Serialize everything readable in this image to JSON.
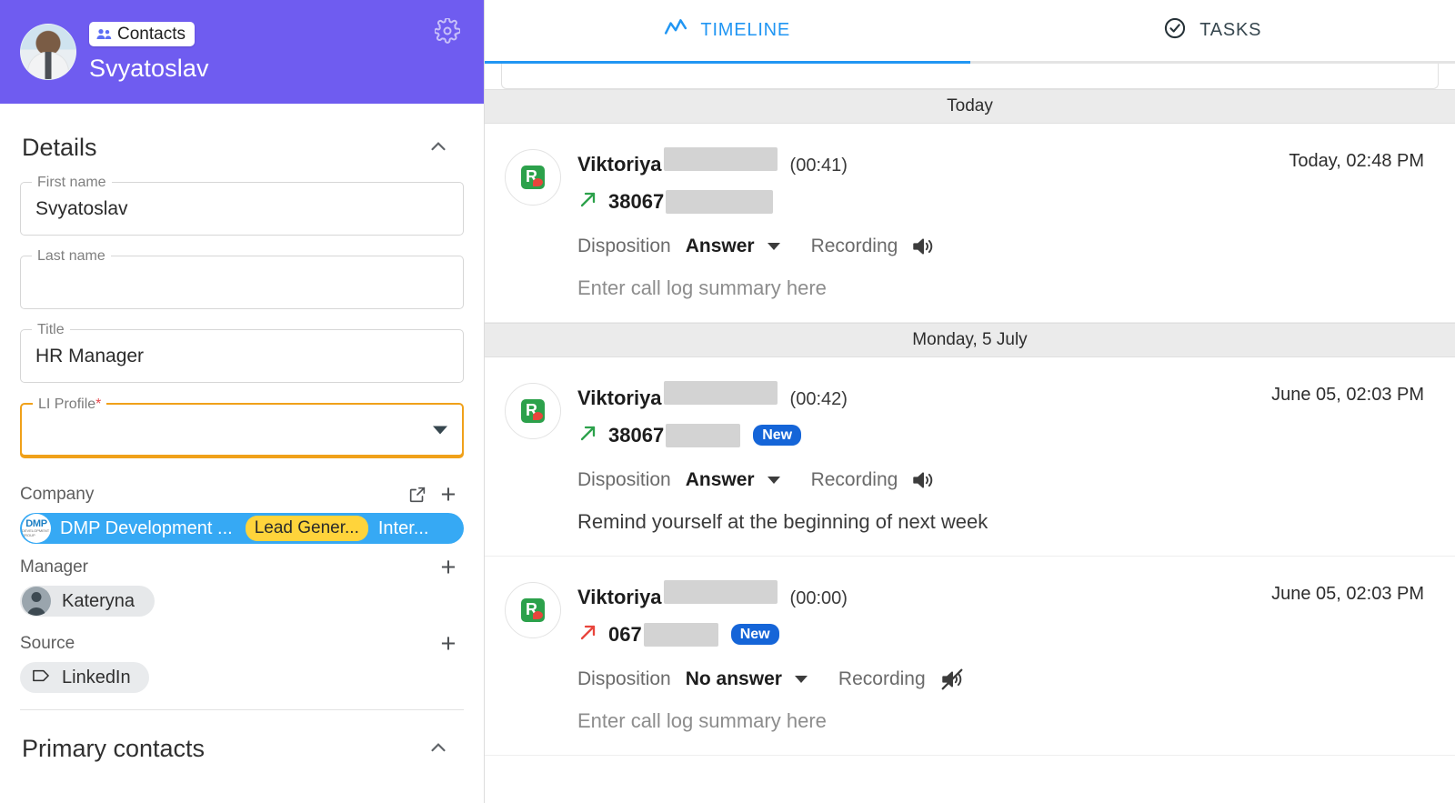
{
  "sidebar": {
    "header": {
      "badge_label": "Contacts",
      "badge_icon": "people-icon",
      "contact_name": "Svyatoslav",
      "gear_icon": "gear-icon",
      "background_color": "#6f5cf0"
    },
    "details": {
      "title": "Details",
      "collapse_icon": "chevron-up-icon",
      "fields": [
        {
          "label": "First name",
          "value": "Svyatoslav",
          "required": false,
          "type": "text",
          "focused": false
        },
        {
          "label": "Last name",
          "value": "",
          "required": false,
          "type": "text",
          "focused": false
        },
        {
          "label": "Title",
          "value": "HR Manager",
          "required": false,
          "type": "text",
          "focused": false
        },
        {
          "label": "LI Profile",
          "value": "",
          "required": true,
          "type": "select",
          "focused": true
        }
      ]
    },
    "relations": [
      {
        "label": "Company",
        "actions": [
          "open-in-new-icon",
          "add-icon"
        ],
        "chip": {
          "kind": "company",
          "logo_text_1": "DMP",
          "logo_text_2": "DEVELOPMENT GROUP",
          "name": "DMP Development ...",
          "tag": "Lead Gener...",
          "tail": "Inter...",
          "chip_color": "#36a9f4",
          "tag_color": "#ffd43b"
        }
      },
      {
        "label": "Manager",
        "actions": [
          "add-icon"
        ],
        "chip": {
          "kind": "person",
          "name": "Kateryna"
        }
      },
      {
        "label": "Source",
        "actions": [
          "add-icon"
        ],
        "chip": {
          "kind": "tag",
          "name": "LinkedIn",
          "icon": "tag-icon"
        }
      }
    ],
    "primary_contacts": {
      "title": "Primary contacts",
      "collapse_icon": "chevron-up-icon"
    }
  },
  "main": {
    "tabs": [
      {
        "label": "TIMELINE",
        "icon": "activity-timeline-icon",
        "active": true
      },
      {
        "label": "TASKS",
        "icon": "check-circle-icon",
        "active": false
      }
    ],
    "active_tab_color": "#2196f3",
    "timeline": [
      {
        "separator": "Today",
        "entries": [
          {
            "provider_icon": "ringcentral-icon",
            "caller": "Viktoriya",
            "caller_redacted": true,
            "duration": "(00:41)",
            "timestamp": "Today, 02:48 PM",
            "direction_icon": "arrow-outgoing-icon",
            "direction_color": "#2ca14b",
            "phone": "38067",
            "phone_redacted": true,
            "badge": "",
            "disposition_label": "Disposition",
            "disposition_value": "Answer",
            "recording_label": "Recording",
            "recording_icon": "speaker-on-icon",
            "summary": "Enter call log summary here",
            "summary_is_placeholder": true
          }
        ]
      },
      {
        "separator": "Monday, 5 July",
        "entries": [
          {
            "provider_icon": "ringcentral-icon",
            "caller": "Viktoriya",
            "caller_redacted": true,
            "duration": "(00:42)",
            "timestamp": "June 05, 02:03 PM",
            "direction_icon": "arrow-outgoing-icon",
            "direction_color": "#2ca14b",
            "phone": "38067",
            "phone_redacted": true,
            "badge": "New",
            "disposition_label": "Disposition",
            "disposition_value": "Answer",
            "recording_label": "Recording",
            "recording_icon": "speaker-on-icon",
            "summary": "Remind yourself at the beginning of next week",
            "summary_is_placeholder": false
          },
          {
            "provider_icon": "ringcentral-icon",
            "caller": "Viktoriya",
            "caller_redacted": true,
            "duration": "(00:00)",
            "timestamp": "June 05, 02:03 PM",
            "direction_icon": "arrow-outgoing-icon",
            "direction_color": "#e8453c",
            "phone": "067",
            "phone_redacted": true,
            "badge": "New",
            "disposition_label": "Disposition",
            "disposition_value": "No answer",
            "recording_label": "Recording",
            "recording_icon": "speaker-muted-icon",
            "summary": "Enter call log summary here",
            "summary_is_placeholder": true
          }
        ]
      }
    ]
  }
}
